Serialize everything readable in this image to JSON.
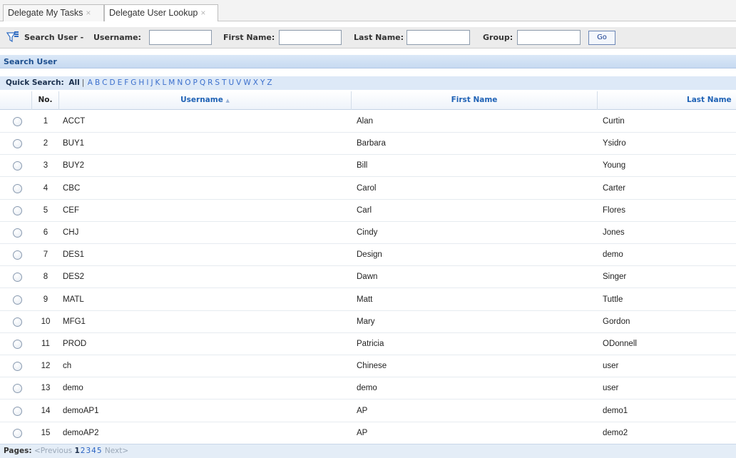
{
  "tabs": [
    {
      "label": "Delegate My Tasks",
      "close": "×"
    },
    {
      "label": "Delegate User Lookup",
      "close": "×"
    }
  ],
  "search": {
    "title": "Search User -",
    "username_label": "Username:",
    "username_value": "",
    "firstname_label": "First Name:",
    "firstname_value": "",
    "lastname_label": "Last Name:",
    "lastname_value": "",
    "group_label": "Group:",
    "group_value": "",
    "go_label": "Go",
    "icon": "filter-icon"
  },
  "section": {
    "title": "Search User"
  },
  "quick_search": {
    "label": "Quick Search:",
    "all": "All",
    "separator": "|",
    "letters": [
      "A",
      "B",
      "C",
      "D",
      "E",
      "F",
      "G",
      "H",
      "I",
      "J",
      "K",
      "L",
      "M",
      "N",
      "O",
      "P",
      "Q",
      "R",
      "S",
      "T",
      "U",
      "V",
      "W",
      "X",
      "Y",
      "Z"
    ]
  },
  "table": {
    "columns": {
      "no": "No.",
      "username": "Username",
      "sort_indicator": "▲",
      "first_name": "First Name",
      "last_name": "Last Name"
    },
    "rows": [
      {
        "no": "1",
        "username": "ACCT",
        "first": "Alan",
        "last": "Curtin"
      },
      {
        "no": "2",
        "username": "BUY1",
        "first": "Barbara",
        "last": "Ysidro"
      },
      {
        "no": "3",
        "username": "BUY2",
        "first": "Bill",
        "last": "Young"
      },
      {
        "no": "4",
        "username": "CBC",
        "first": "Carol",
        "last": "Carter"
      },
      {
        "no": "5",
        "username": "CEF",
        "first": "Carl",
        "last": "Flores"
      },
      {
        "no": "6",
        "username": "CHJ",
        "first": "Cindy",
        "last": "Jones"
      },
      {
        "no": "7",
        "username": "DES1",
        "first": "Design",
        "last": "demo"
      },
      {
        "no": "8",
        "username": "DES2",
        "first": "Dawn",
        "last": "Singer"
      },
      {
        "no": "9",
        "username": "MATL",
        "first": "Matt",
        "last": "Tuttle"
      },
      {
        "no": "10",
        "username": "MFG1",
        "first": "Mary",
        "last": "Gordon"
      },
      {
        "no": "11",
        "username": "PROD",
        "first": "Patricia",
        "last": "ODonnell"
      },
      {
        "no": "12",
        "username": "ch",
        "first": "Chinese",
        "last": "user"
      },
      {
        "no": "13",
        "username": "demo",
        "first": "demo",
        "last": "user"
      },
      {
        "no": "14",
        "username": "demoAP1",
        "first": "AP",
        "last": "demo1"
      },
      {
        "no": "15",
        "username": "demoAP2",
        "first": "AP",
        "last": "demo2"
      }
    ]
  },
  "pager": {
    "label": "Pages:",
    "previous": "<Previous",
    "pages": [
      "1",
      "2",
      "3",
      "4",
      "5"
    ],
    "current": "1",
    "next": "Next>"
  }
}
